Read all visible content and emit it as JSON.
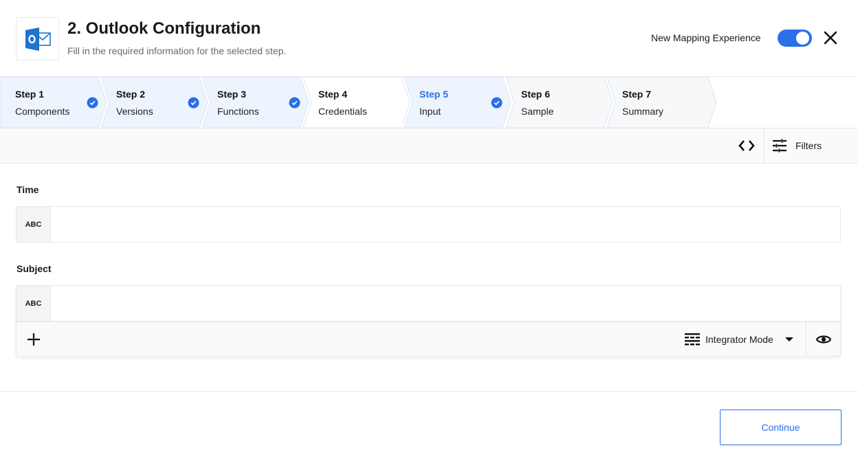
{
  "header": {
    "title": "2. Outlook Configuration",
    "subtitle": "Fill in the required information for the selected step.",
    "logo_icon": "outlook-logo-icon",
    "new_mapping_label": "New Mapping Experience",
    "new_mapping_enabled": true,
    "close_icon": "close-icon"
  },
  "stepper": {
    "steps": [
      {
        "number": "Step 1",
        "name": "Components",
        "completed": true,
        "state": "visited"
      },
      {
        "number": "Step 2",
        "name": "Versions",
        "completed": true,
        "state": "visited"
      },
      {
        "number": "Step 3",
        "name": "Functions",
        "completed": true,
        "state": "visited"
      },
      {
        "number": "Step 4",
        "name": "Credentials",
        "completed": false,
        "state": "plain"
      },
      {
        "number": "Step 5",
        "name": "Input",
        "completed": true,
        "state": "active"
      },
      {
        "number": "Step 6",
        "name": "Sample",
        "completed": false,
        "state": "upcoming"
      },
      {
        "number": "Step 7",
        "name": "Summary",
        "completed": false,
        "state": "upcoming"
      }
    ]
  },
  "toolbar": {
    "code_icon": "code-icon",
    "filters_icon": "sliders-icon",
    "filters_label": "Filters"
  },
  "fields": [
    {
      "label": "Time",
      "type_badge": "ABC",
      "value": "",
      "placeholder": ""
    },
    {
      "label": "Subject",
      "type_badge": "ABC",
      "value": "",
      "placeholder": ""
    }
  ],
  "subject_footer": {
    "add_icon": "plus-icon",
    "mode_icon": "list-icon",
    "mode_label": "Integrator Mode",
    "caret_icon": "caret-down-icon",
    "preview_icon": "eye-icon"
  },
  "actions": {
    "continue_label": "Continue"
  },
  "colors": {
    "accent": "#2a6ee8",
    "visited_step_bg": "#eef4fd",
    "upcoming_step_bg": "#f7f8fa"
  }
}
